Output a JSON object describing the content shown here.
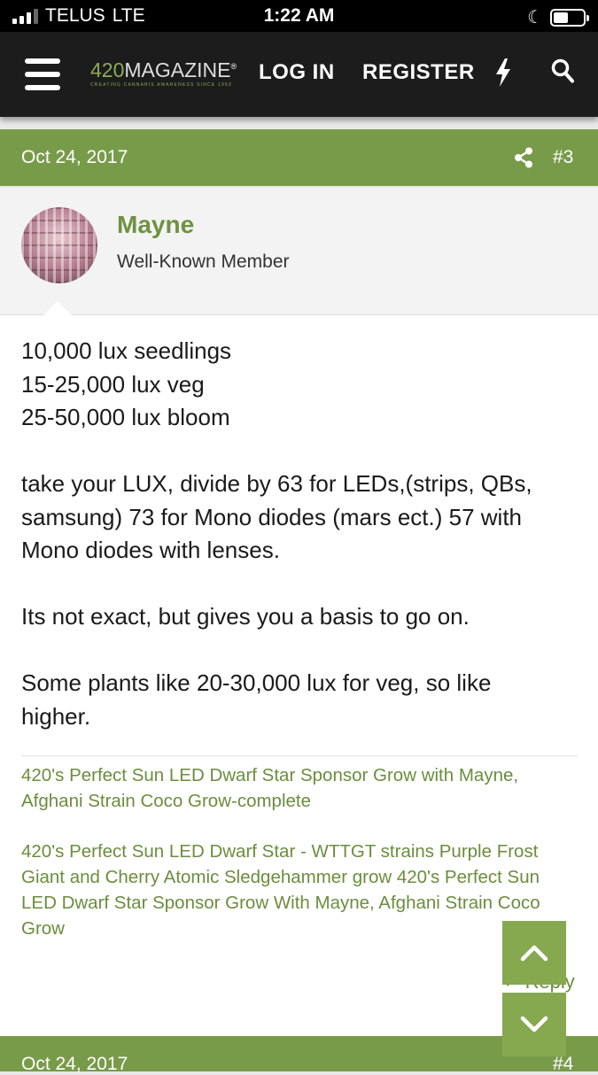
{
  "status_bar": {
    "carrier": "TELUS",
    "network": "LTE",
    "time": "1:22 AM"
  },
  "nav": {
    "logo_number": "420",
    "logo_word": "MAGAZINE",
    "logo_tagline": "CREATING CANNABIS AWARENESS SINCE 1993",
    "login_label": "LOG IN",
    "register_label": "REGISTER",
    "icons": [
      "menu-icon",
      "lightning-icon",
      "search-icon"
    ]
  },
  "post": {
    "date": "Oct 24, 2017",
    "number": "#3",
    "author_name": "Mayne",
    "author_title": "Well-Known Member",
    "lines": [
      "10,000 lux seedlings",
      "15-25,000 lux veg",
      "25-50,000 lux bloom",
      "",
      "take your LUX, divide by 63 for LEDs,(strips, QBs,",
      "samsung) 73 for Mono diodes (mars ect.) 57 with",
      "Mono diodes with lenses.",
      "",
      "Its not exact, but gives you a basis to go on.",
      "",
      "Some plants like 20-30,000 lux for veg, so like",
      "higher."
    ],
    "signature_1": "420's Perfect Sun LED Dwarf Star Sponsor Grow with Mayne, Afghani Strain Coco Grow-complete",
    "signature_2": "420's Perfect Sun LED Dwarf Star - WTTGT strains Purple Frost Giant and Cherry Atomic Sledgehammer grow 420's Perfect Sun LED Dwarf Star Sponsor Grow With Mayne, Afghani Strain Coco Grow",
    "reply_label": "Reply"
  },
  "next_post": {
    "date": "Oct 24, 2017",
    "number": "#4"
  },
  "colors": {
    "accent_green": "#789b4a",
    "link_green": "#6b8d3d",
    "nav_bg": "#1c1c1c"
  }
}
